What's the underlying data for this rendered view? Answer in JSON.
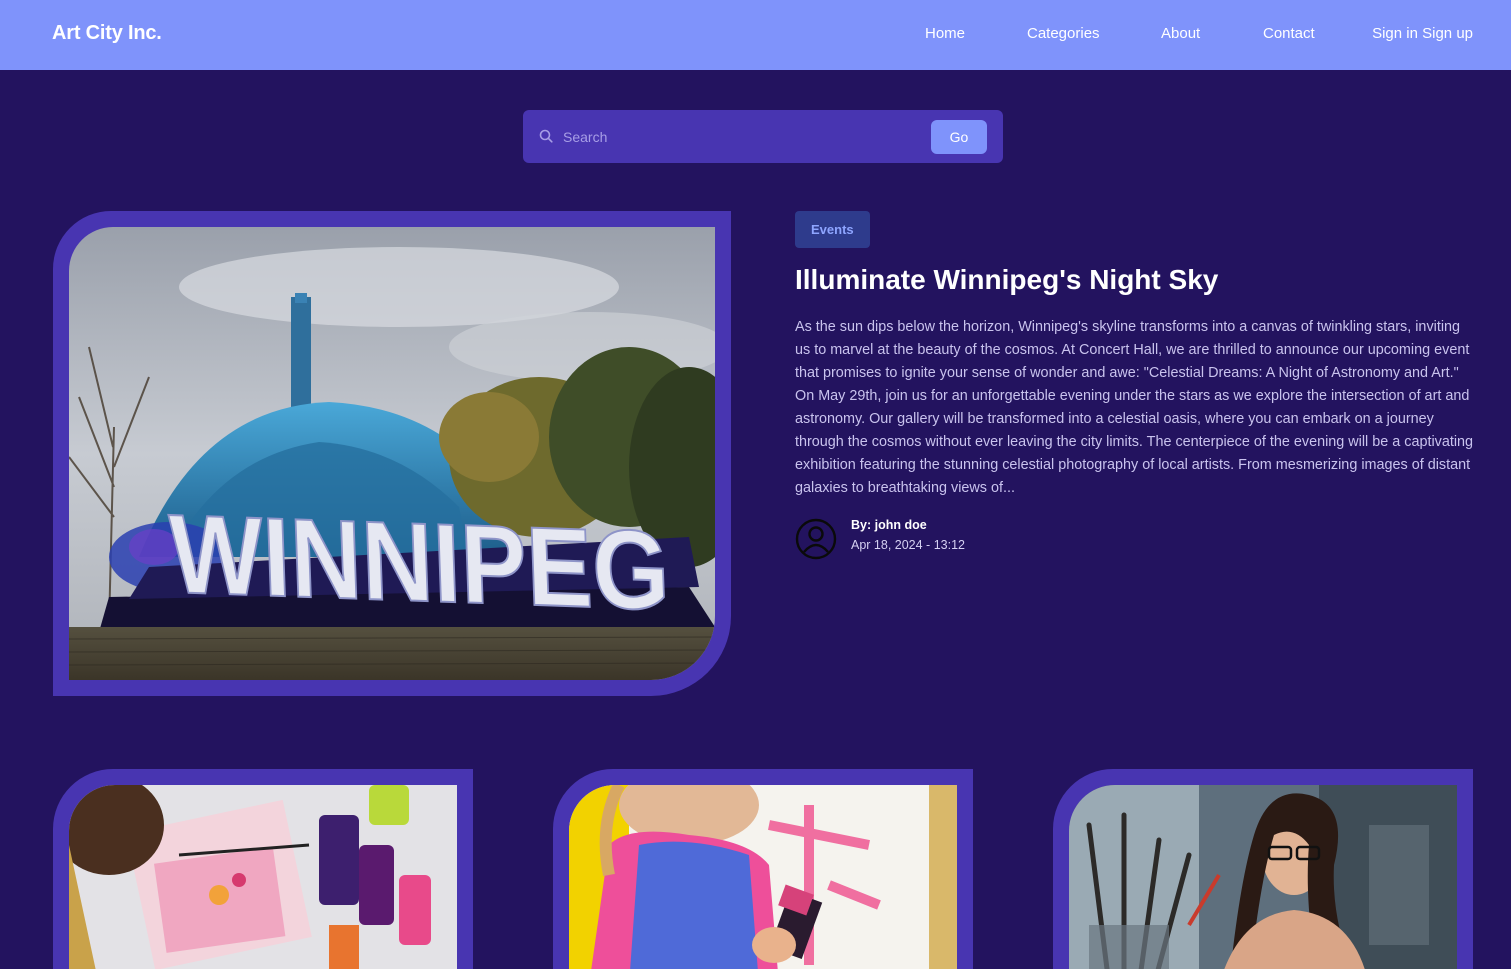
{
  "header": {
    "brand": "Art City Inc.",
    "nav": [
      "Home",
      "Categories",
      "About",
      "Contact"
    ],
    "sign_in": "Sign in",
    "sign_up": "Sign up"
  },
  "search": {
    "placeholder": "Search",
    "button": "Go"
  },
  "featured": {
    "category": "Events",
    "title": "Illuminate Winnipeg's Night Sky",
    "excerpt": "As the sun dips below the horizon, Winnipeg's skyline transforms into a canvas of twinkling stars, inviting us to marvel at the beauty of the cosmos. At Concert Hall, we are thrilled to announce our upcoming event that promises to ignite your sense of wonder and awe: \"Celestial Dreams: A Night of Astronomy and Art.\" On May 29th, join us for an unforgettable evening under the stars as we explore the intersection of art and astronomy. Our gallery will be transformed into a celestial oasis, where you can embark on a journey through the cosmos without ever leaving the city limits. The centerpiece of the evening will be a captivating exhibition featuring the stunning celestial photography of local artists. From mesmerizing images of distant galaxies to breathtaking views of...",
    "author": "By: john doe",
    "date": "Apr 18, 2024 - 13:12",
    "image_sign_text": "WINNIPEG"
  },
  "colors": {
    "background": "#23135f",
    "navbar": "#7f93fb",
    "frame": "#4835b1",
    "badge_bg": "#2e3b8c",
    "badge_text": "#8ea5ff"
  },
  "icons": {
    "search": "search-icon",
    "avatar": "user-circle-icon"
  }
}
